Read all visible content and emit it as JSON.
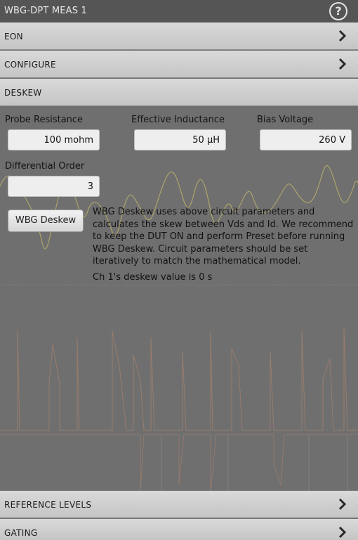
{
  "window": {
    "title": "WBG-DPT MEAS 1",
    "help_icon": "help-circle-icon"
  },
  "sections": {
    "eon": "EON",
    "configure": "CONFIGURE",
    "deskew": "DESKEW",
    "reference_levels": "REFERENCE LEVELS",
    "gating": "GATING"
  },
  "deskew": {
    "probe_resistance_label": "Probe Resistance",
    "probe_resistance_value": "100 mohm",
    "effective_inductance_label": "Effective Inductance",
    "effective_inductance_value": "50 µH",
    "bias_voltage_label": "Bias Voltage",
    "bias_voltage_value": "260 V",
    "differential_order_label": "Differential Order",
    "differential_order_value": "3",
    "button_label": "WBG Deskew",
    "description": "WBG Deskew uses above circuit parameters and calculates the skew between Vds and Id. We recommend to keep the DUT ON and perform Preset before running WBG Deskew. Circuit parameters should be set iteratively to match the mathematical model.",
    "status": "Ch 1's deskew value is 0 s"
  },
  "colors": {
    "background": "#6f6f6f",
    "titlebar": "#555555",
    "waveform_yellow": "#b7ad6a",
    "waveform_orange": "#a8826c"
  }
}
